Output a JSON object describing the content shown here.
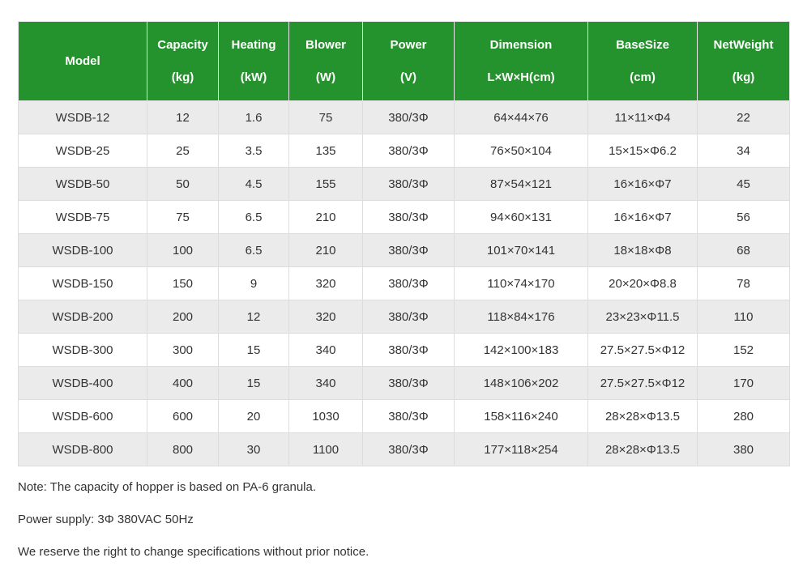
{
  "table": {
    "headers": [
      {
        "line1": "Model",
        "line2": ""
      },
      {
        "line1": "Capacity",
        "line2": "(kg)"
      },
      {
        "line1": "Heating",
        "line2": "(kW)"
      },
      {
        "line1": "Blower",
        "line2": "(W)"
      },
      {
        "line1": "Power",
        "line2": "(V)"
      },
      {
        "line1": "Dimension",
        "line2": "L×W×H(cm)"
      },
      {
        "line1": "BaseSize",
        "line2": "(cm)"
      },
      {
        "line1": "NetWeight",
        "line2": "(kg)"
      }
    ],
    "rows": [
      [
        "WSDB-12",
        "12",
        "1.6",
        "75",
        "380/3Φ",
        "64×44×76",
        "11×11×Φ4",
        "22"
      ],
      [
        "WSDB-25",
        "25",
        "3.5",
        "135",
        "380/3Φ",
        "76×50×104",
        "15×15×Φ6.2",
        "34"
      ],
      [
        "WSDB-50",
        "50",
        "4.5",
        "155",
        "380/3Φ",
        "87×54×121",
        "16×16×Φ7",
        "45"
      ],
      [
        "WSDB-75",
        "75",
        "6.5",
        "210",
        "380/3Φ",
        "94×60×131",
        "16×16×Φ7",
        "56"
      ],
      [
        "WSDB-100",
        "100",
        "6.5",
        "210",
        "380/3Φ",
        "101×70×141",
        "18×18×Φ8",
        "68"
      ],
      [
        "WSDB-150",
        "150",
        "9",
        "320",
        "380/3Φ",
        "110×74×170",
        "20×20×Φ8.8",
        "78"
      ],
      [
        "WSDB-200",
        "200",
        "12",
        "320",
        "380/3Φ",
        "118×84×176",
        "23×23×Φ11.5",
        "110"
      ],
      [
        "WSDB-300",
        "300",
        "15",
        "340",
        "380/3Φ",
        "142×100×183",
        "27.5×27.5×Φ12",
        "152"
      ],
      [
        "WSDB-400",
        "400",
        "15",
        "340",
        "380/3Φ",
        "148×106×202",
        "27.5×27.5×Φ12",
        "170"
      ],
      [
        "WSDB-600",
        "600",
        "20",
        "1030",
        "380/3Φ",
        "158×116×240",
        "28×28×Φ13.5",
        "280"
      ],
      [
        "WSDB-800",
        "800",
        "30",
        "1100",
        "380/3Φ",
        "177×118×254",
        "28×28×Φ13.5",
        "380"
      ]
    ]
  },
  "notes": {
    "note": "Note: The capacity of hopper is based on PA-6 granula.",
    "power_supply": "Power supply: 3Φ 380VAC 50Hz",
    "disclaimer": "We reserve the right to change specifications without prior notice."
  },
  "colors": {
    "header_bg": "#25932d",
    "header_text": "#ffffff",
    "row_alt_bg": "#ebebeb",
    "border": "#dddddd"
  }
}
